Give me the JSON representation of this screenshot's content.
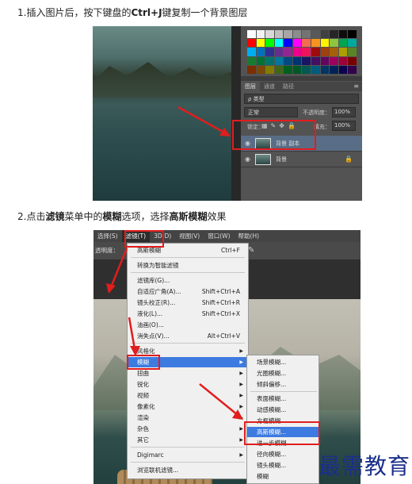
{
  "steps": [
    {
      "text_a": "1.插入图片后，按下键盘的",
      "text_b": "Ctrl+J",
      "text_c": "键复制一个背景图层"
    },
    {
      "text_a": "2.点击",
      "text_b": "滤镜",
      "text_c": "菜单中的",
      "text_d": "模糊",
      "text_e": "选项，选择",
      "text_f": "高斯模糊",
      "text_g": "效果"
    }
  ],
  "shot1": {
    "tabs": [
      "图层",
      "通道",
      "路径"
    ],
    "menu_icon": "≡",
    "filter_label": "ρ 类型",
    "blend_mode": "正常",
    "opacity_label": "不透明度：",
    "opacity_value": "100%",
    "lock_label": "锁定：",
    "fill_label": "填充：",
    "fill_value": "100%",
    "layers": [
      {
        "name": "背景 副本",
        "selected": true
      },
      {
        "name": "背景",
        "selected": false,
        "locked": true
      }
    ],
    "swatch_colors": [
      "#ffffff",
      "#f2f2f2",
      "#d9d9d9",
      "#bfbfbf",
      "#a6a6a6",
      "#8c8c8c",
      "#737373",
      "#595959",
      "#404040",
      "#262626",
      "#0d0d0d",
      "#000000",
      "#ff0000",
      "#ffff00",
      "#00ff00",
      "#00ffff",
      "#0000ff",
      "#ff00ff",
      "#f26c4f",
      "#f7941d",
      "#fff200",
      "#8dc63f",
      "#00a651",
      "#00a99d",
      "#00aeef",
      "#0072bc",
      "#2e3192",
      "#662d91",
      "#92278f",
      "#ec008c",
      "#ed145b",
      "#9e0b0f",
      "#a0410d",
      "#a36209",
      "#aba000",
      "#598527",
      "#197b30",
      "#007236",
      "#00746b",
      "#0076a3",
      "#004a80",
      "#003471",
      "#1b1464",
      "#440e62",
      "#630460",
      "#9e005d",
      "#9e0039",
      "#790000",
      "#7b2e00",
      "#7d4900",
      "#827b00",
      "#406618",
      "#005e20",
      "#005826",
      "#005952",
      "#005b7f",
      "#003663",
      "#002157",
      "#0d004c",
      "#32004b"
    ]
  },
  "shot2": {
    "menubar": [
      "选择(S)",
      "滤镜(T)",
      "3D(D)",
      "视图(V)",
      "窗口(W)",
      "帮助(H)"
    ],
    "options_label": "透明度：",
    "filter_menu": [
      {
        "label": "高斯模糊",
        "shortcut": "Ctrl+F"
      },
      {
        "label": "转换为智能滤镜"
      },
      {
        "label": "滤镜库(G)..."
      },
      {
        "label": "自适应广角(A)...",
        "shortcut": "Shift+Ctrl+A"
      },
      {
        "label": "镜头校正(R)...",
        "shortcut": "Shift+Ctrl+R"
      },
      {
        "label": "液化(L)...",
        "shortcut": "Shift+Ctrl+X"
      },
      {
        "label": "油画(O)..."
      },
      {
        "label": "消失点(V)...",
        "shortcut": "Alt+Ctrl+V"
      },
      {
        "label": "风格化",
        "sub": "▶"
      },
      {
        "label": "模糊",
        "sub": "▶"
      },
      {
        "label": "扭曲",
        "sub": "▶"
      },
      {
        "label": "锐化",
        "sub": "▶"
      },
      {
        "label": "视频",
        "sub": "▶"
      },
      {
        "label": "像素化",
        "sub": "▶"
      },
      {
        "label": "渲染",
        "sub": "▶"
      },
      {
        "label": "杂色",
        "sub": "▶"
      },
      {
        "label": "其它",
        "sub": "▶"
      },
      {
        "label": "Digimarc",
        "sub": "▶"
      },
      {
        "label": "浏览联机滤镜..."
      }
    ],
    "blur_menu": [
      "场景模糊...",
      "光圈模糊...",
      "倾斜偏移...",
      "表面模糊...",
      "动感模糊...",
      "方框模糊...",
      "高斯模糊...",
      "进一步模糊",
      "径向模糊...",
      "镜头模糊...",
      "模糊"
    ]
  },
  "watermark": "最需教育",
  "colors": {
    "highlight_red": "#e21d1d",
    "menu_select": "#3d7be0",
    "watermark": "#1a2f8a"
  }
}
